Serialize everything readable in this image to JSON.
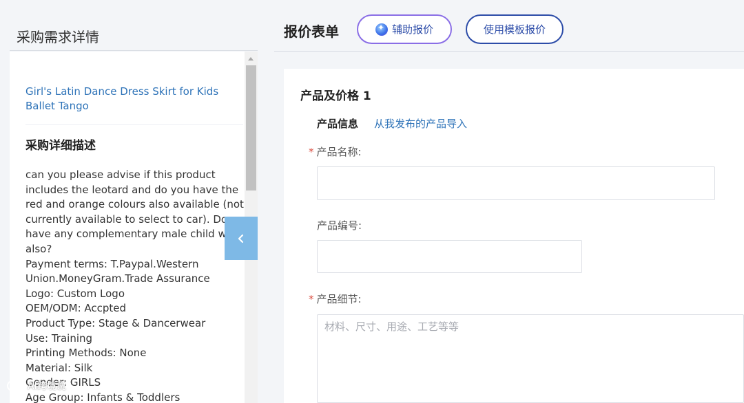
{
  "left_panel": {
    "title": "采购需求详情",
    "product_link": "Girl's Latin Dance Dress Skirt for Kids Ballet Tango",
    "detail_heading": "采购详细描述",
    "detail_lines": [
      "can you please advise if this product",
      "includes the leotard and do you have the",
      "red and orange colours also available (not",
      "currently available to select to car). Do you",
      "have any complementary male child wear",
      "also?",
      "Payment terms: T.Paypal.Western",
      "Union.MoneyGram.Trade Assurance",
      "Logo: Custom Logo",
      "OEM/ODM: Accpted",
      "Product Type: Stage & Dancerwear",
      "Use: Training",
      "Printing Methods: None",
      "Material: Silk",
      "Gender: GIRLS",
      "Age Group: Infants & Toddlers"
    ]
  },
  "header": {
    "title": "报价表单",
    "assist_button": "辅助报价",
    "template_button": "使用模板报价"
  },
  "form": {
    "section_title": "产品及价格 1",
    "info_label": "产品信息",
    "import_link": "从我发布的产品导入",
    "name_label": "产品名称:",
    "code_label": "产品编号:",
    "detail_label": "产品细节:",
    "detail_placeholder": "材料、尺寸、用途、工艺等等",
    "required_mark": "*"
  },
  "watermark": "AI跨境说",
  "colors": {
    "link": "#2e73b8",
    "button_border": "#2c4ca8",
    "required": "#d94a3d",
    "toggle": "#7eb9e6"
  }
}
